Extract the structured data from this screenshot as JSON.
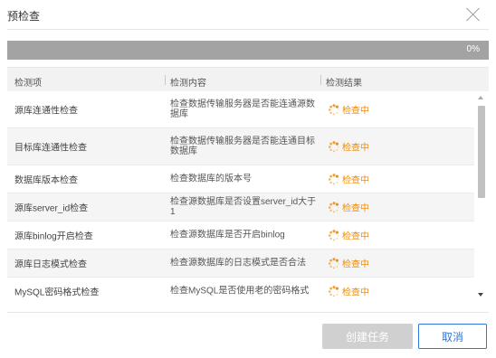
{
  "dialog": {
    "title": "预检查",
    "close_icon": "close-icon"
  },
  "progress": {
    "text": "0%",
    "value": 0
  },
  "table": {
    "headers": [
      "检测项",
      "检测内容",
      "检测结果"
    ],
    "rows": [
      {
        "item": "源库连通性检查",
        "content": "检查数据传输服务器是否能连通源数据库",
        "result": "检查中"
      },
      {
        "item": "目标库连通性检查",
        "content": "检查数据传输服务器是否能连通目标数据库",
        "result": "检查中"
      },
      {
        "item": "数据库版本检查",
        "content": "检查数据库的版本号",
        "result": "检查中"
      },
      {
        "item": "源库server_id检查",
        "content": "检查源数据库是否设置server_id大于1",
        "result": "检查中"
      },
      {
        "item": "源库binlog开启检查",
        "content": "检查源数据库是否开启binlog",
        "result": "检查中"
      },
      {
        "item": "源库日志模式检查",
        "content": "检查源数据库的日志模式是否合法",
        "result": "检查中"
      },
      {
        "item": "MySQL密码格式检查",
        "content": "检查MySQL是否使用老的密码格式",
        "result": "检查中"
      }
    ],
    "result_icon": "loading-spinner-icon",
    "result_color": "#f08c0a"
  },
  "footer": {
    "create_label": "创建任务",
    "cancel_label": "取消"
  },
  "colors": {
    "progress_bg": "#a3a3a3",
    "primary": "#2f77d7",
    "disabled": "#d0d0d0"
  }
}
